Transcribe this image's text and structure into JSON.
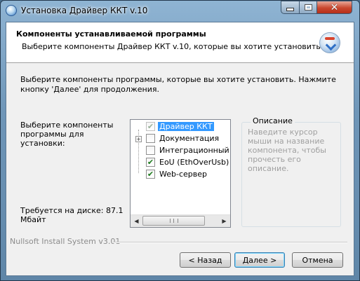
{
  "window": {
    "title": "Установка Драйвер ККТ v.10",
    "controls": {
      "minimize": "minimize",
      "maximize": "maximize",
      "close": "✕"
    }
  },
  "header": {
    "title": "Компоненты устанавливаемой программы",
    "subtitle": "Выберите компоненты Драйвер ККТ v.10, которые вы хотите установить."
  },
  "body": {
    "intro": "Выберите компоненты программы, которые вы хотите установить. Нажмите кнопку 'Далее' для продолжения.",
    "select_label": "Выберите компоненты программы для установки:",
    "disk_label": "Требуется на диске: 87.1 Мбайт"
  },
  "components": [
    {
      "label": "Драйвер ККТ",
      "checked": true,
      "disabled": true,
      "selected": true,
      "expandable": false
    },
    {
      "label": "Документация",
      "checked": false,
      "disabled": false,
      "selected": false,
      "expandable": true
    },
    {
      "label": "Интеграционный компонент",
      "checked": false,
      "disabled": false,
      "selected": false,
      "expandable": false
    },
    {
      "label": "EoU (EthOverUsb)",
      "checked": true,
      "disabled": false,
      "selected": false,
      "expandable": false
    },
    {
      "label": "Web-сервер",
      "checked": true,
      "disabled": false,
      "selected": false,
      "expandable": false
    }
  ],
  "description": {
    "title": "Описание",
    "text": "Наведите курсор мыши на название компонента, чтобы прочесть его описание."
  },
  "footer": {
    "branding": "Nullsoft Install System v3.01",
    "back": "< Назад",
    "next": "Далее >",
    "cancel": "Отмена"
  },
  "icons": {
    "app": "installer-disc-icon",
    "header_logo": "nsis-install-icon",
    "check": "✔"
  }
}
